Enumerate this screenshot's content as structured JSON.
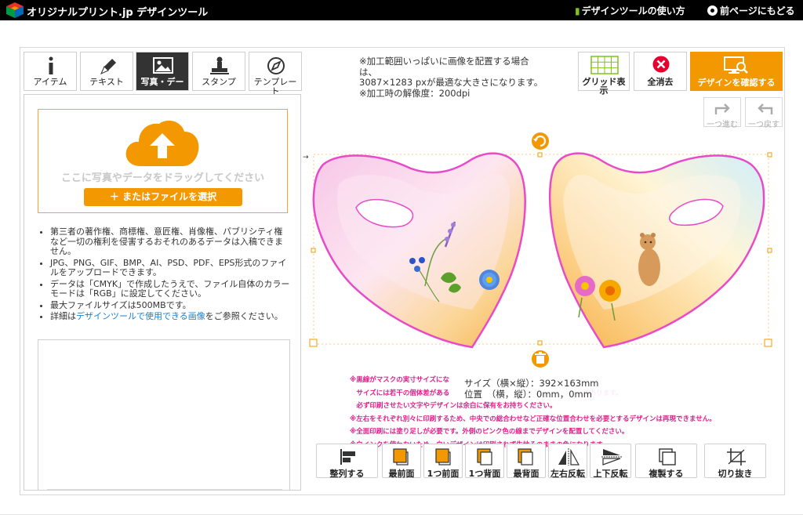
{
  "header": {
    "logo_text": "オリジナルプリント.jp デザインツール",
    "how_to_label": "デザインツールの使い方",
    "back_label": "前ページにもどる"
  },
  "tabs": [
    {
      "label": "アイテム",
      "icon": "info-icon"
    },
    {
      "label": "テキスト",
      "icon": "pen-icon"
    },
    {
      "label": "写真・デー",
      "icon": "image-icon"
    },
    {
      "label": "スタンプ",
      "icon": "stamp-icon"
    },
    {
      "label": "テンプレー\nト",
      "icon": "template-icon"
    }
  ],
  "upload": {
    "drop_text": "ここに写真やデータをドラッグしてください",
    "select_label": "＋ またはファイルを選択"
  },
  "notes": [
    "第三者の著作権、商標権、意匠権、肖像権、パブリシティ権など一切の権利を侵害するおそれのあるデータは入稿できません。",
    "JPG、PNG、GIF、BMP、AI、PSD、PDF、EPS形式のファイルをアップロードできます。",
    "データは「CMYK」で作成したうえで、ファイル自体のカラーモードは「RGB」に設定してください。",
    "最大ファイルサイズは500MBです。"
  ],
  "note_link": {
    "prefix": "詳細は",
    "link": "デザインツールで使用できる画像",
    "suffix": "をご参照ください。"
  },
  "info": {
    "line1": "※加工範囲いっぱいに画像を配置する場合は、",
    "line2": "3087×1283 pxが最適な大きさになります。",
    "line3": "※加工時の解像度：200dpi"
  },
  "top_buttons": {
    "grid": "グリッド表示",
    "clear": "全消去",
    "confirm": "デザインを確認する"
  },
  "undo_buttons": {
    "redo": "一つ進む",
    "undo": "一つ戻す"
  },
  "canvas": {
    "small_label": "→"
  },
  "size_info": {
    "size": "サイズ（横×縦）：392×163mm",
    "position": "位置　（横，縦）：0mm，0mm"
  },
  "warnings": [
    "※黒線がマスクの実寸サイズにな　　　　　　　　　　　　　　　　　　",
    "　サイズには若干の個体差がある　　　　　　　　　　　　　　　　　　　　があります。",
    "　必ず印刷させたい文字やデザインは余白に保有をお持ちください。",
    "※左右をそれぞれ別々に印刷するため、中央での総合わせなど正確な位置合わせを必要とするデザインは再現できません。",
    "※全面印刷には塗り足しが必要です。外側のピンク色の線までデザインを配置してください。",
    "※白インクを使わないため、白いデザインは印刷されず生地そのままの色になります。"
  ],
  "bottom_buttons": {
    "align": "整列する",
    "front": "最前面",
    "forward": "1つ前面",
    "backward": "1つ背面",
    "back": "最背面",
    "flip_h": "左右反転",
    "flip_v": "上下反転",
    "duplicate": "複製する",
    "crop": "切り抜き"
  },
  "colors": {
    "accent": "#f39800",
    "pink": "#e0208a",
    "link": "#1a7fd0",
    "header": "#000000"
  }
}
